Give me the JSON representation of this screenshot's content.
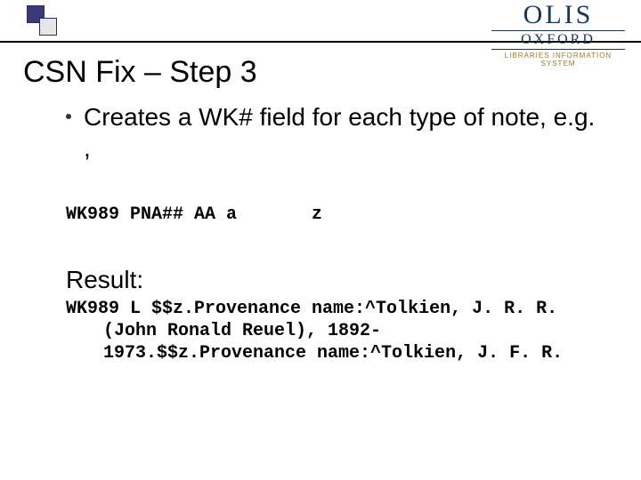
{
  "logo": {
    "name": "OLIS",
    "org": "OXFORD",
    "sub": "LIBRARIES   INFORMATION SYSTEM"
  },
  "title": "CSN Fix – Step 3",
  "bullet": "Creates a WK# field for each type of note, e.g. ,",
  "code": "WK989 PNA## AA a       z",
  "result_label": "Result:",
  "result_text": "WK989 L $$z.Provenance name:^Tolkien, J. R. R. (John Ronald Reuel), 1892-1973.$$z.Provenance name:^Tolkien, J. F. R."
}
